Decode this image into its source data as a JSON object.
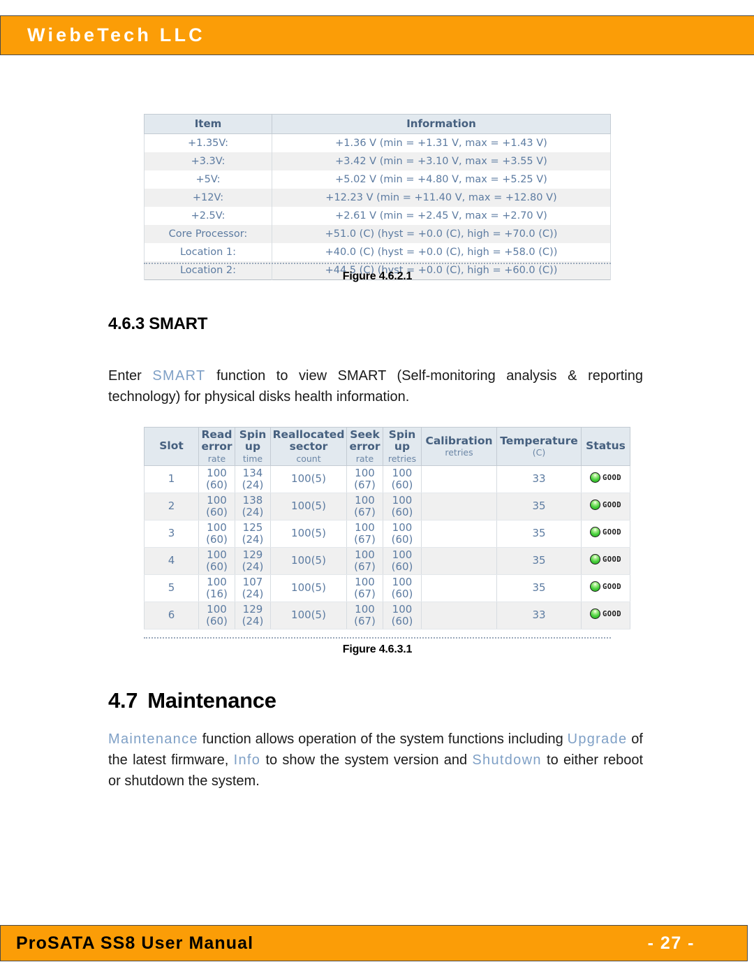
{
  "header": {
    "title": "WiebeTech LLC"
  },
  "footer": {
    "manual_title": "ProSATA SS8 User Manual",
    "page_label": "- 27 -"
  },
  "sensor_table": {
    "headers": [
      "Item",
      "Information"
    ],
    "rows": [
      {
        "item": "+1.35V:",
        "information": "+1.36 V (min = +1.31 V, max = +1.43 V)"
      },
      {
        "item": "+3.3V:",
        "information": "+3.42 V (min = +3.10 V, max = +3.55 V)"
      },
      {
        "item": "+5V:",
        "information": "+5.02 V (min = +4.80 V, max = +5.25 V)"
      },
      {
        "item": "+12V:",
        "information": "+12.23 V (min = +11.40 V, max = +12.80 V)"
      },
      {
        "item": "+2.5V:",
        "information": "+2.61 V (min = +2.45 V, max = +2.70 V)"
      },
      {
        "item": "Core Processor:",
        "information": "+51.0 (C) (hyst = +0.0 (C), high = +70.0 (C))"
      },
      {
        "item": "Location 1:",
        "information": "+40.0 (C) (hyst = +0.0 (C), high = +58.0 (C))"
      },
      {
        "item": "Location 2:",
        "information": "+44.5 (C) (hyst = +0.0 (C), high = +60.0 (C))"
      }
    ]
  },
  "figure_1": {
    "caption": "Figure 4.6.2.1"
  },
  "section_smart": {
    "heading": "4.6.3 SMART",
    "paragraph": {
      "lead": "Enter ",
      "term": "SMART",
      "rest": " function to view SMART (Self-monitoring analysis & reporting technology) for physical disks health information."
    }
  },
  "smart_table": {
    "headers": [
      {
        "main": "Slot",
        "sub": ""
      },
      {
        "main": "Read error",
        "sub": "rate"
      },
      {
        "main": "Spin up",
        "sub": "time"
      },
      {
        "main": "Reallocated sector",
        "sub": "count"
      },
      {
        "main": "Seek error",
        "sub": "rate"
      },
      {
        "main": "Spin up",
        "sub": "retries"
      },
      {
        "main": "Calibration",
        "sub": "retries"
      },
      {
        "main": "Temperature",
        "sub": "(C)"
      },
      {
        "main": "Status",
        "sub": ""
      }
    ],
    "rows": [
      {
        "slot": "1",
        "read_error_rate": "100",
        "read_error_rate_thresh": "(60)",
        "spin_up_time": "134",
        "spin_up_time_thresh": "(24)",
        "reallocated_sector_count": "100(5)",
        "seek_error_rate": "100",
        "seek_error_rate_thresh": "(67)",
        "spin_up_retries": "100",
        "spin_up_retries_thresh": "(60)",
        "calibration_retries": "",
        "temperature": "33",
        "status": "GOOD"
      },
      {
        "slot": "2",
        "read_error_rate": "100",
        "read_error_rate_thresh": "(60)",
        "spin_up_time": "138",
        "spin_up_time_thresh": "(24)",
        "reallocated_sector_count": "100(5)",
        "seek_error_rate": "100",
        "seek_error_rate_thresh": "(67)",
        "spin_up_retries": "100",
        "spin_up_retries_thresh": "(60)",
        "calibration_retries": "",
        "temperature": "35",
        "status": "GOOD"
      },
      {
        "slot": "3",
        "read_error_rate": "100",
        "read_error_rate_thresh": "(60)",
        "spin_up_time": "125",
        "spin_up_time_thresh": "(24)",
        "reallocated_sector_count": "100(5)",
        "seek_error_rate": "100",
        "seek_error_rate_thresh": "(67)",
        "spin_up_retries": "100",
        "spin_up_retries_thresh": "(60)",
        "calibration_retries": "",
        "temperature": "35",
        "status": "GOOD"
      },
      {
        "slot": "4",
        "read_error_rate": "100",
        "read_error_rate_thresh": "(60)",
        "spin_up_time": "129",
        "spin_up_time_thresh": "(24)",
        "reallocated_sector_count": "100(5)",
        "seek_error_rate": "100",
        "seek_error_rate_thresh": "(67)",
        "spin_up_retries": "100",
        "spin_up_retries_thresh": "(60)",
        "calibration_retries": "",
        "temperature": "35",
        "status": "GOOD"
      },
      {
        "slot": "5",
        "read_error_rate": "100",
        "read_error_rate_thresh": "(16)",
        "spin_up_time": "107",
        "spin_up_time_thresh": "(24)",
        "reallocated_sector_count": "100(5)",
        "seek_error_rate": "100",
        "seek_error_rate_thresh": "(67)",
        "spin_up_retries": "100",
        "spin_up_retries_thresh": "(60)",
        "calibration_retries": "",
        "temperature": "35",
        "status": "GOOD"
      },
      {
        "slot": "6",
        "read_error_rate": "100",
        "read_error_rate_thresh": "(60)",
        "spin_up_time": "129",
        "spin_up_time_thresh": "(24)",
        "reallocated_sector_count": "100(5)",
        "seek_error_rate": "100",
        "seek_error_rate_thresh": "(67)",
        "spin_up_retries": "100",
        "spin_up_retries_thresh": "(60)",
        "calibration_retries": "",
        "temperature": "33",
        "status": "GOOD"
      }
    ]
  },
  "figure_2": {
    "caption": "Figure 4.6.3.1"
  },
  "section_maintenance": {
    "heading_number": "4.7",
    "heading_text": "Maintenance",
    "paragraph": {
      "term_1": "Maintenance",
      "text_1": " function allows operation of the system functions including ",
      "term_2": "Upgrade",
      "text_2": " of the latest firmware, ",
      "term_3": "Info",
      "text_3": " to show the system version and ",
      "term_4": "Shutdown",
      "text_4": " to either reboot or shutdown the system."
    }
  }
}
